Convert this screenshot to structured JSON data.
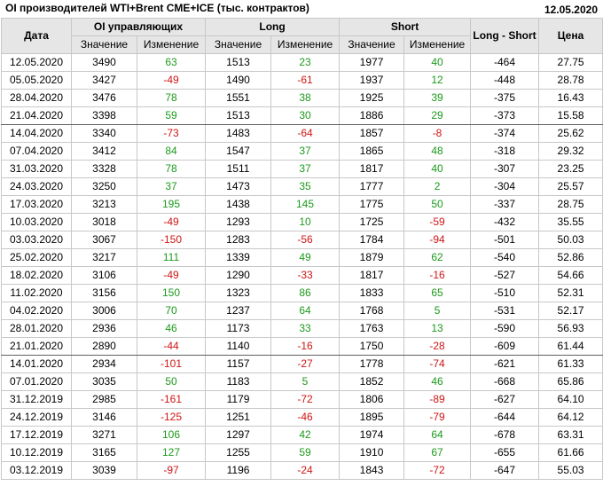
{
  "header": {
    "title": "OI производителей WTI+Brent CME+ICE (тыс. контрактов)",
    "date": "12.05.2020"
  },
  "table": {
    "col_date": "Дата",
    "group_oi": "OI управляющих",
    "group_long": "Long",
    "group_short": "Short",
    "col_long_short": "Long - Short",
    "col_price": "Цена",
    "sub_value": "Значение",
    "sub_change": "Изменение",
    "rows": [
      {
        "date": "12.05.2020",
        "oi": "3490",
        "oi_ch": "63",
        "long": "1513",
        "long_ch": "23",
        "short": "1977",
        "short_ch": "40",
        "ls": "-464",
        "price": "27.75"
      },
      {
        "date": "05.05.2020",
        "oi": "3427",
        "oi_ch": "-49",
        "long": "1490",
        "long_ch": "-61",
        "short": "1937",
        "short_ch": "12",
        "ls": "-448",
        "price": "28.78"
      },
      {
        "date": "28.04.2020",
        "oi": "3476",
        "oi_ch": "78",
        "long": "1551",
        "long_ch": "38",
        "short": "1925",
        "short_ch": "39",
        "ls": "-375",
        "price": "16.43"
      },
      {
        "date": "21.04.2020",
        "oi": "3398",
        "oi_ch": "59",
        "long": "1513",
        "long_ch": "30",
        "short": "1886",
        "short_ch": "29",
        "ls": "-373",
        "price": "15.58"
      },
      {
        "date": "14.04.2020",
        "oi": "3340",
        "oi_ch": "-73",
        "long": "1483",
        "long_ch": "-64",
        "short": "1857",
        "short_ch": "-8",
        "ls": "-374",
        "price": "25.62"
      },
      {
        "date": "07.04.2020",
        "oi": "3412",
        "oi_ch": "84",
        "long": "1547",
        "long_ch": "37",
        "short": "1865",
        "short_ch": "48",
        "ls": "-318",
        "price": "29.32"
      },
      {
        "date": "31.03.2020",
        "oi": "3328",
        "oi_ch": "78",
        "long": "1511",
        "long_ch": "37",
        "short": "1817",
        "short_ch": "40",
        "ls": "-307",
        "price": "23.25"
      },
      {
        "date": "24.03.2020",
        "oi": "3250",
        "oi_ch": "37",
        "long": "1473",
        "long_ch": "35",
        "short": "1777",
        "short_ch": "2",
        "ls": "-304",
        "price": "25.57"
      },
      {
        "date": "17.03.2020",
        "oi": "3213",
        "oi_ch": "195",
        "long": "1438",
        "long_ch": "145",
        "short": "1775",
        "short_ch": "50",
        "ls": "-337",
        "price": "28.75"
      },
      {
        "date": "10.03.2020",
        "oi": "3018",
        "oi_ch": "-49",
        "long": "1293",
        "long_ch": "10",
        "short": "1725",
        "short_ch": "-59",
        "ls": "-432",
        "price": "35.55"
      },
      {
        "date": "03.03.2020",
        "oi": "3067",
        "oi_ch": "-150",
        "long": "1283",
        "long_ch": "-56",
        "short": "1784",
        "short_ch": "-94",
        "ls": "-501",
        "price": "50.03"
      },
      {
        "date": "25.02.2020",
        "oi": "3217",
        "oi_ch": "111",
        "long": "1339",
        "long_ch": "49",
        "short": "1879",
        "short_ch": "62",
        "ls": "-540",
        "price": "52.86"
      },
      {
        "date": "18.02.2020",
        "oi": "3106",
        "oi_ch": "-49",
        "long": "1290",
        "long_ch": "-33",
        "short": "1817",
        "short_ch": "-16",
        "ls": "-527",
        "price": "54.66"
      },
      {
        "date": "11.02.2020",
        "oi": "3156",
        "oi_ch": "150",
        "long": "1323",
        "long_ch": "86",
        "short": "1833",
        "short_ch": "65",
        "ls": "-510",
        "price": "52.31"
      },
      {
        "date": "04.02.2020",
        "oi": "3006",
        "oi_ch": "70",
        "long": "1237",
        "long_ch": "64",
        "short": "1768",
        "short_ch": "5",
        "ls": "-531",
        "price": "52.17"
      },
      {
        "date": "28.01.2020",
        "oi": "2936",
        "oi_ch": "46",
        "long": "1173",
        "long_ch": "33",
        "short": "1763",
        "short_ch": "13",
        "ls": "-590",
        "price": "56.93"
      },
      {
        "date": "21.01.2020",
        "oi": "2890",
        "oi_ch": "-44",
        "long": "1140",
        "long_ch": "-16",
        "short": "1750",
        "short_ch": "-28",
        "ls": "-609",
        "price": "61.44"
      },
      {
        "date": "14.01.2020",
        "oi": "2934",
        "oi_ch": "-101",
        "long": "1157",
        "long_ch": "-27",
        "short": "1778",
        "short_ch": "-74",
        "ls": "-621",
        "price": "61.33"
      },
      {
        "date": "07.01.2020",
        "oi": "3035",
        "oi_ch": "50",
        "long": "1183",
        "long_ch": "5",
        "short": "1852",
        "short_ch": "46",
        "ls": "-668",
        "price": "65.86"
      },
      {
        "date": "31.12.2019",
        "oi": "2985",
        "oi_ch": "-161",
        "long": "1179",
        "long_ch": "-72",
        "short": "1806",
        "short_ch": "-89",
        "ls": "-627",
        "price": "64.10"
      },
      {
        "date": "24.12.2019",
        "oi": "3146",
        "oi_ch": "-125",
        "long": "1251",
        "long_ch": "-46",
        "short": "1895",
        "short_ch": "-79",
        "ls": "-644",
        "price": "64.12"
      },
      {
        "date": "17.12.2019",
        "oi": "3271",
        "oi_ch": "106",
        "long": "1297",
        "long_ch": "42",
        "short": "1974",
        "short_ch": "64",
        "ls": "-678",
        "price": "63.31"
      },
      {
        "date": "10.12.2019",
        "oi": "3165",
        "oi_ch": "127",
        "long": "1255",
        "long_ch": "59",
        "short": "1910",
        "short_ch": "67",
        "ls": "-655",
        "price": "61.66"
      },
      {
        "date": "03.12.2019",
        "oi": "3039",
        "oi_ch": "-97",
        "long": "1196",
        "long_ch": "-24",
        "short": "1843",
        "short_ch": "-72",
        "ls": "-647",
        "price": "55.03"
      }
    ]
  },
  "colors": {
    "positive": "#1c9a1c",
    "negative": "#d01515",
    "header_bg": "#e6e6e6",
    "grid": "#c8c8c8"
  }
}
